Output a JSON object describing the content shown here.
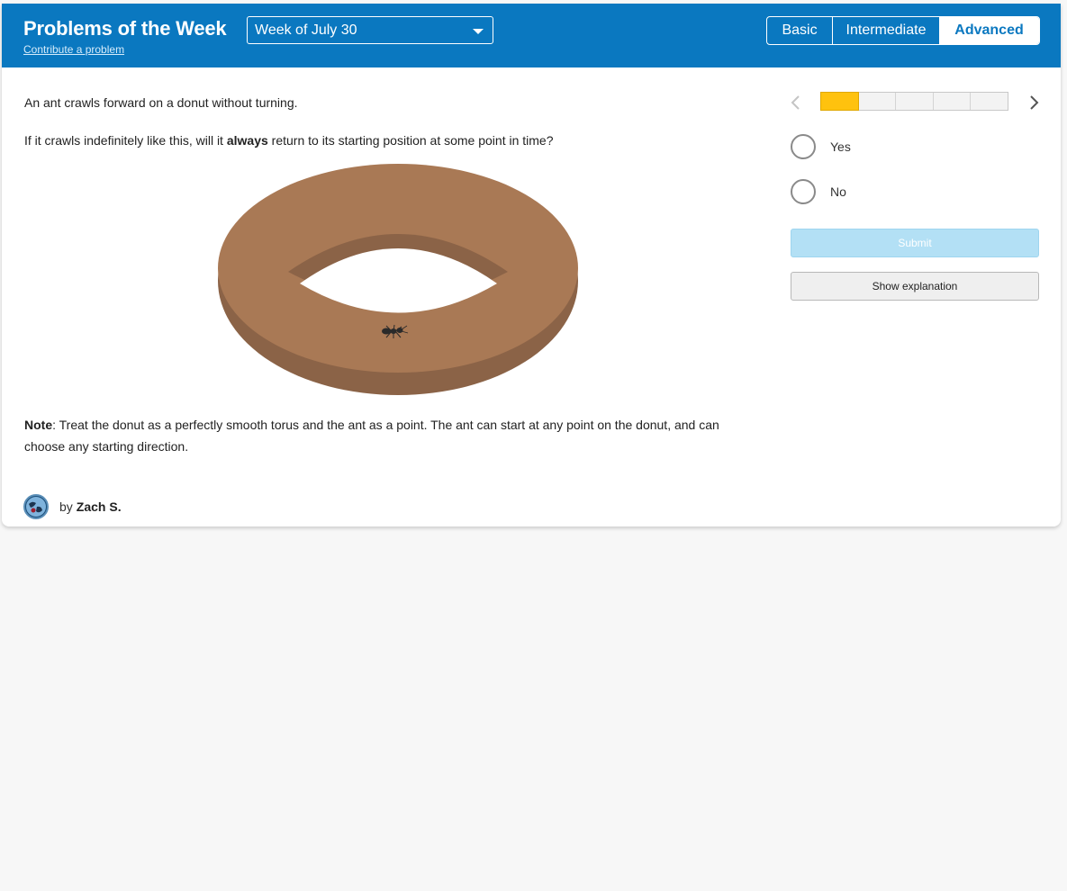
{
  "header": {
    "title": "Problems of the Week",
    "contribute_link": "Contribute a problem",
    "week_select": {
      "selected": "Week of July 30"
    },
    "levels": [
      {
        "label": "Basic",
        "selected": false
      },
      {
        "label": "Intermediate",
        "selected": false
      },
      {
        "label": "Advanced",
        "selected": true
      }
    ]
  },
  "problem": {
    "line1": "An ant crawls forward on a donut without turning.",
    "line2_before": "If it crawls indefinitely like this, will it ",
    "line2_bold": "always",
    "line2_after": " return to its starting position at some point in time?",
    "note_label": "Note",
    "note_text": ": Treat the donut as a perfectly smooth torus and the ant as a point. The ant can start at any point on the donut, and can choose any starting direction.",
    "author_prefix": "by",
    "author_name": "Zach S."
  },
  "progress": {
    "current": 1,
    "total": 5
  },
  "options": [
    {
      "label": "Yes",
      "checked": false
    },
    {
      "label": "No",
      "checked": false
    }
  ],
  "buttons": {
    "submit": "Submit",
    "explanation": "Show explanation"
  },
  "colors": {
    "header_bg": "#0a78c0",
    "donut_top": "#a97955",
    "donut_side": "#8b6347",
    "progress_active": "#ffc20e",
    "submit_disabled": "#b3e0f5",
    "page_bg": "#f7f7f7"
  },
  "icons": {
    "prev": "chevron-left-icon",
    "next": "chevron-right-icon",
    "dropdown": "caret-down-icon",
    "avatar": "globe-avatar-icon",
    "illustration": "ant-on-donut"
  }
}
